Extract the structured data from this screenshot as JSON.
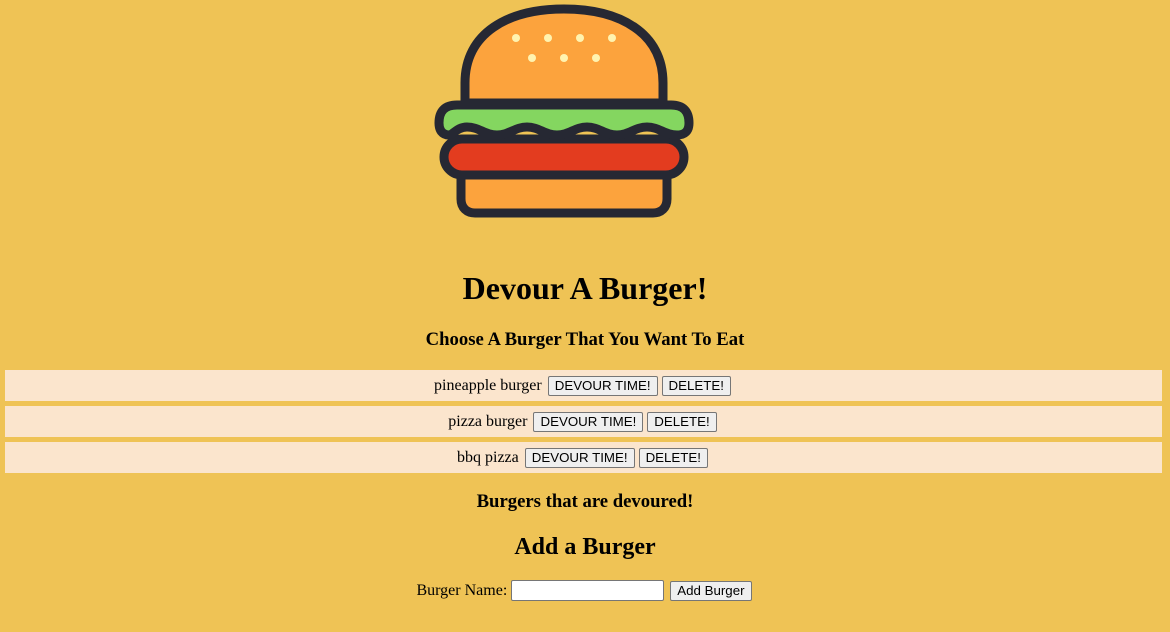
{
  "header": {
    "logo_icon": "hamburger-icon",
    "title": "Devour A Burger!",
    "subtitle": "Choose A Burger That You Want To Eat"
  },
  "burgers": [
    {
      "name": "pineapple burger",
      "devour_label": "DEVOUR TIME!",
      "delete_label": "DELETE!"
    },
    {
      "name": "pizza burger",
      "devour_label": "DEVOUR TIME!",
      "delete_label": "DELETE!"
    },
    {
      "name": "bbq pizza",
      "devour_label": "DEVOUR TIME!",
      "delete_label": "DELETE!"
    }
  ],
  "devoured": {
    "title": "Burgers that are devoured!"
  },
  "add_form": {
    "title": "Add a Burger",
    "label": "Burger Name:",
    "input_value": "",
    "submit_label": "Add Burger"
  },
  "colors": {
    "background": "#efc355",
    "row_background": "#fbe5cd",
    "bun": "#fca33d",
    "lettuce": "#84d660",
    "patty": "#e33c1f",
    "outline": "#262833"
  }
}
